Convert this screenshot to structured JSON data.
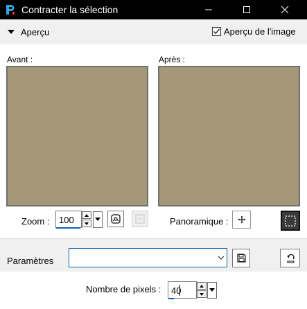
{
  "window": {
    "title": "Contracter la sélection"
  },
  "header": {
    "apercu_label": "Aperçu",
    "apercu_image_label": "Aperçu de l'image",
    "apercu_image_checked": true
  },
  "preview": {
    "before_label": "Avant :",
    "after_label": "Après :",
    "fill_color": "#a59878"
  },
  "zoom": {
    "label": "Zoom :",
    "value": "100"
  },
  "pan": {
    "label": "Panoramique :"
  },
  "params": {
    "label": "Paramètres",
    "value": ""
  },
  "settings": {
    "pixels_label": "Nombre de pixels :",
    "pixels_value": "40"
  },
  "colors": {
    "accent": "#0a64ad",
    "titlebar": "#000000",
    "app_icon": "#2da8e0"
  }
}
